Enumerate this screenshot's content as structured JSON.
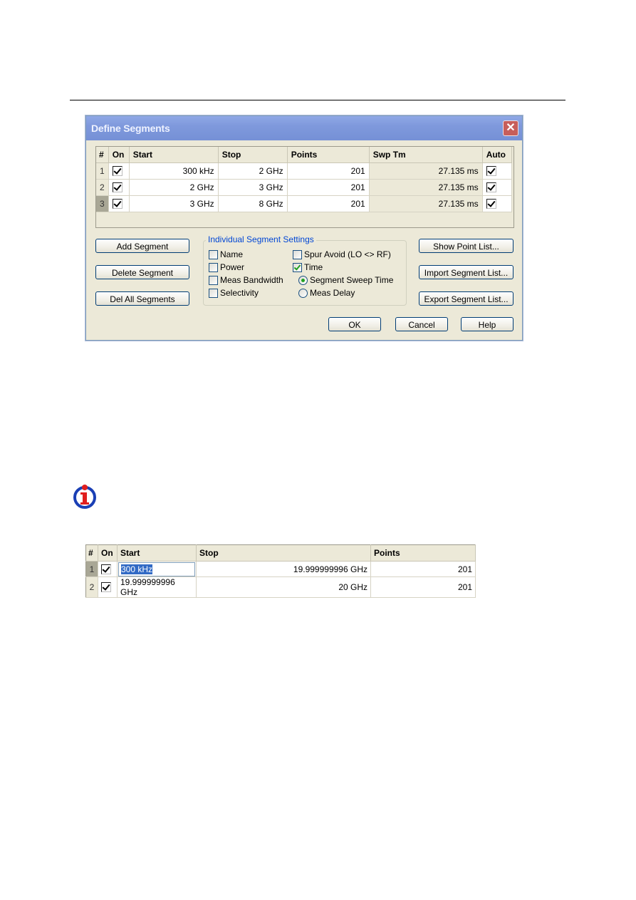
{
  "dialog": {
    "title": "Define Segments",
    "close_icon": "close-icon",
    "table": {
      "headers": [
        "#",
        "On",
        "Start",
        "Stop",
        "Points",
        "Swp Tm",
        "Auto"
      ],
      "rows": [
        {
          "num": "1",
          "on": true,
          "start": "300 kHz",
          "stop": "2 GHz",
          "points": "201",
          "swp_tm": "27.135 ms",
          "auto": true
        },
        {
          "num": "2",
          "on": true,
          "start": "2 GHz",
          "stop": "3 GHz",
          "points": "201",
          "swp_tm": "27.135 ms",
          "auto": true
        },
        {
          "num": "3",
          "on": true,
          "start": "3 GHz",
          "stop": "8 GHz",
          "points": "201",
          "swp_tm": "27.135 ms",
          "auto": true
        }
      ],
      "selected_row": 3
    },
    "buttons": {
      "add_segment": "Add Segment",
      "delete_segment": "Delete Segment",
      "del_all_segments": "Del All Segments",
      "show_point_list": "Show Point List...",
      "import_segment_list": "Import Segment List...",
      "export_segment_list": "Export Segment List...",
      "ok": "OK",
      "cancel": "Cancel",
      "help": "Help"
    },
    "individual_settings": {
      "label": "Individual Segment Settings",
      "name": {
        "label": "Name",
        "checked": false
      },
      "power": {
        "label": "Power",
        "checked": false
      },
      "meas_bandwidth": {
        "label": "Meas Bandwidth",
        "checked": false
      },
      "selectivity": {
        "label": "Selectivity",
        "checked": false
      },
      "spur_avoid": {
        "label": "Spur Avoid (LO <> RF)",
        "checked": false
      },
      "time": {
        "label": "Time",
        "checked": true
      },
      "segment_sweep_time": {
        "label": "Segment Sweep Time",
        "selected": true
      },
      "meas_delay": {
        "label": "Meas Delay",
        "selected": false
      }
    }
  },
  "info_icon": "info-icon",
  "example_table": {
    "headers": [
      "#",
      "On",
      "Start",
      "Stop",
      "Points"
    ],
    "rows": [
      {
        "num": "1",
        "on": true,
        "start": "300 kHz",
        "stop": "19.999999996 GHz",
        "points": "201"
      },
      {
        "num": "2",
        "on": true,
        "start": "19.999999996 GHz",
        "stop": "20 GHz",
        "points": "201"
      }
    ],
    "editing_cell": "rows.0.start"
  }
}
